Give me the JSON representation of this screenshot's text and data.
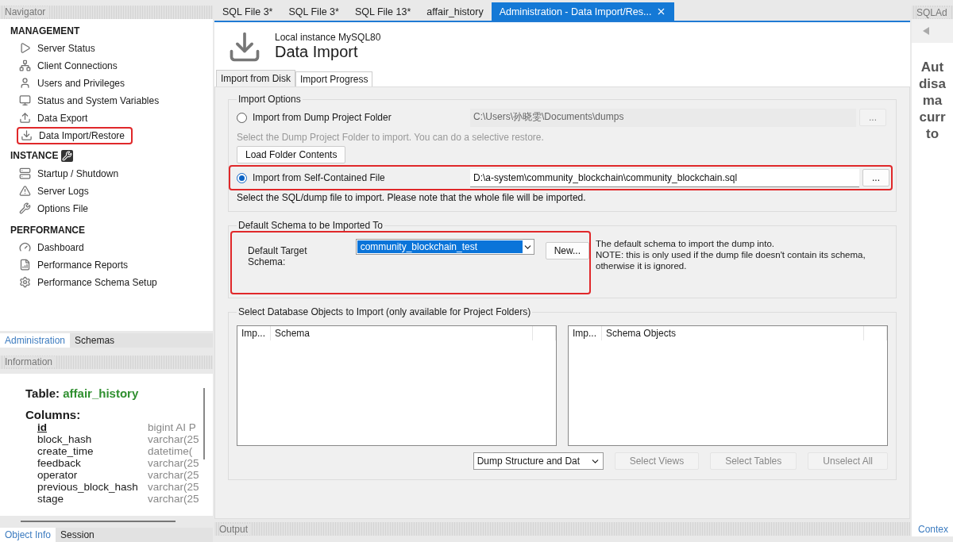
{
  "navigator": {
    "title": "Navigator",
    "sections": [
      {
        "title": "MANAGEMENT",
        "items": [
          {
            "label": "Server Status",
            "highlighted": false
          },
          {
            "label": "Client Connections",
            "highlighted": false
          },
          {
            "label": "Users and Privileges",
            "highlighted": false
          },
          {
            "label": "Status and System Variables",
            "highlighted": false
          },
          {
            "label": "Data Export",
            "highlighted": false
          },
          {
            "label": "Data Import/Restore",
            "highlighted": true
          }
        ]
      },
      {
        "title": "INSTANCE",
        "items": [
          {
            "label": "Startup / Shutdown",
            "highlighted": false
          },
          {
            "label": "Server Logs",
            "highlighted": false
          },
          {
            "label": "Options File",
            "highlighted": false
          }
        ]
      },
      {
        "title": "PERFORMANCE",
        "items": [
          {
            "label": "Dashboard",
            "highlighted": false
          },
          {
            "label": "Performance Reports",
            "highlighted": false
          },
          {
            "label": "Performance Schema Setup",
            "highlighted": false
          }
        ]
      }
    ]
  },
  "navigator_tabs": [
    {
      "label": "Administration",
      "selected": true
    },
    {
      "label": "Schemas",
      "selected": false
    }
  ],
  "information": {
    "title": "Information",
    "table_label": "Table:",
    "table_name": "affair_history",
    "columns_label": "Columns:",
    "columns": [
      {
        "name": "id",
        "type": "bigint AI P",
        "primary_key": true
      },
      {
        "name": "block_hash",
        "type": "varchar(25",
        "primary_key": false
      },
      {
        "name": "create_time",
        "type": "datetime(",
        "primary_key": false
      },
      {
        "name": "feedback",
        "type": "varchar(25",
        "primary_key": false
      },
      {
        "name": "operator",
        "type": "varchar(25",
        "primary_key": false
      },
      {
        "name": "previous_block_hash",
        "type": "varchar(25",
        "primary_key": false
      },
      {
        "name": "stage",
        "type": "varchar(25",
        "primary_key": false
      }
    ]
  },
  "info_tabs": [
    {
      "label": "Object Info",
      "selected": true
    },
    {
      "label": "Session",
      "selected": false
    }
  ],
  "editor_tabs": [
    {
      "label": "SQL File 3*",
      "selected": false
    },
    {
      "label": "SQL File 3*",
      "selected": false
    },
    {
      "label": "SQL File 13*",
      "selected": false
    },
    {
      "label": "affair_history",
      "selected": false
    },
    {
      "label": "Administration - Data Import/Res...",
      "selected": true
    }
  ],
  "header": {
    "subtitle": "Local instance MySQL80",
    "title": "Data Import"
  },
  "sub_tabs": [
    {
      "label": "Import from Disk",
      "selected": true
    },
    {
      "label": "Import Progress",
      "selected": false
    }
  ],
  "import_options": {
    "title": "Import Options",
    "options": [
      {
        "label": "Import from Dump Project Folder",
        "selected": false,
        "path": "C:\\Users\\孙晓雯\\Documents\\dumps",
        "highlighted": false,
        "hint": "Select the Dump Project Folder to import. You can do a selective restore.",
        "button": "Load Folder Contents"
      },
      {
        "label": "Import from Self-Contained File",
        "selected": true,
        "path": "D:\\a-system\\community_blockchain\\community_blockchain.sql",
        "highlighted": true,
        "hint": "Select the SQL/dump file to import. Please note that the whole file will be imported."
      }
    ],
    "browse": "..."
  },
  "default_schema": {
    "title": "Default Schema to be Imported To",
    "label": "Default Target Schema:",
    "value": "community_blockchain_test",
    "new_button": "New...",
    "highlighted": true,
    "note": [
      "The default schema to import the dump into.",
      "NOTE: this is only used if the dump file doesn't contain its schema,",
      "otherwise it is ignored."
    ]
  },
  "objects": {
    "title": "Select Database Objects to Import (only available for Project Folders)",
    "lists": [
      {
        "columns": [
          "Imp...",
          "Schema"
        ]
      },
      {
        "columns": [
          "Imp...",
          "Schema Objects"
        ]
      }
    ],
    "dump_select": "Dump Structure and Dat",
    "buttons": [
      {
        "label": "Select Views",
        "disabled": true
      },
      {
        "label": "Select Tables",
        "disabled": true
      },
      {
        "label": "Unselect All",
        "disabled": true
      }
    ]
  },
  "output": {
    "title": "Output"
  },
  "right_panel": {
    "title": "SQLAd",
    "lines": [
      "Aut",
      "disa",
      "ma",
      "curr",
      "to"
    ],
    "footer_tab": "Contex"
  }
}
